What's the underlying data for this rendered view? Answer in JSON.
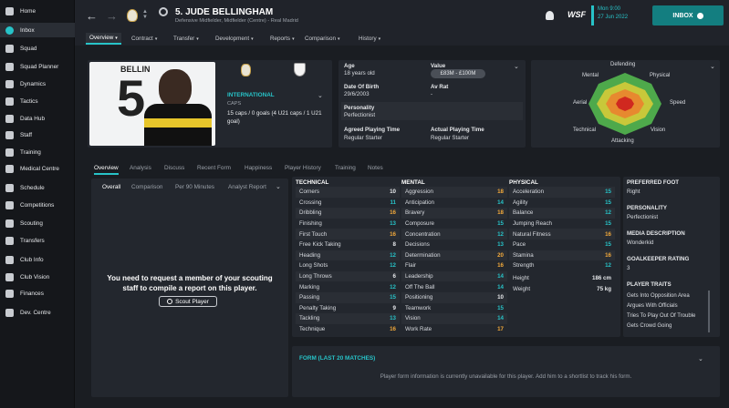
{
  "sidebar": [
    {
      "label": "Home",
      "icon": "home-icon"
    },
    {
      "label": "Inbox",
      "icon": "inbox-icon"
    },
    {
      "label": "Squad",
      "icon": "squad-icon"
    },
    {
      "label": "Squad Planner",
      "icon": "planner-icon"
    },
    {
      "label": "Dynamics",
      "icon": "dynamics-icon"
    },
    {
      "label": "Tactics",
      "icon": "tactics-icon"
    },
    {
      "label": "Data Hub",
      "icon": "data-hub-icon"
    },
    {
      "label": "Staff",
      "icon": "staff-icon"
    },
    {
      "label": "Training",
      "icon": "training-icon"
    },
    {
      "label": "Medical Centre",
      "icon": "medical-icon"
    },
    {
      "label": "Schedule",
      "icon": "calendar-icon"
    },
    {
      "label": "Competitions",
      "icon": "trophy-icon"
    },
    {
      "label": "Scouting",
      "icon": "scouting-icon"
    },
    {
      "label": "Transfers",
      "icon": "transfers-icon"
    },
    {
      "label": "Club Info",
      "icon": "shield-icon"
    },
    {
      "label": "Club Vision",
      "icon": "vision-icon"
    },
    {
      "label": "Finances",
      "icon": "finances-icon"
    },
    {
      "label": "Dev. Centre",
      "icon": "dev-centre-icon"
    }
  ],
  "header": {
    "name": "5. JUDE BELLINGHAM",
    "subtitle": "Defensive Midfielder, Midfielder (Centre) - Real Madrid",
    "day": "Mon 9:00",
    "date": "27 Jun 2022",
    "inbox": "INBOX",
    "brand": "WSF"
  },
  "tabs": [
    "Overview",
    "Contract",
    "Transfer",
    "Development",
    "Reports",
    "Comparison",
    "History"
  ],
  "profile": {
    "shirt_name": "BELLIN",
    "intl_label": "INTERNATIONAL",
    "caps_label": "CAPS",
    "caps_text": "15 caps / 0 goals (4 U21 caps / 1 U21 goal)"
  },
  "info": {
    "age_label": "Age",
    "age": "18 years old",
    "value_label": "Value",
    "value": "£83M - £100M",
    "dob_label": "Date Of Birth",
    "dob": "29/6/2003",
    "avrat_label": "Av Rat",
    "avrat": "-",
    "pers_label": "Personality",
    "pers": "Perfectionist",
    "apt_label": "Agreed Playing Time",
    "apt": "Regular Starter",
    "act_label": "Actual Playing Time",
    "act": "Regular Starter"
  },
  "radar": {
    "labels": [
      "Defending",
      "Physical",
      "Speed",
      "Vision",
      "Attacking",
      "Technical",
      "Aerial",
      "Mental"
    ]
  },
  "subtabs": [
    "Overview",
    "Analysis",
    "Discuss",
    "Recent Form",
    "Happiness",
    "Player History",
    "Training",
    "Notes"
  ],
  "report_tabs": [
    "Overall",
    "Comparison",
    "Per 90 Minutes",
    "Analyst Report"
  ],
  "scout": {
    "message": "You need to request a member of your scouting staff to compile a report on this player.",
    "button": "Scout Player"
  },
  "technical": {
    "title": "TECHNICAL",
    "rows": [
      [
        "Corners",
        "10"
      ],
      [
        "Crossing",
        "11"
      ],
      [
        "Dribbling",
        "16"
      ],
      [
        "Finishing",
        "13"
      ],
      [
        "First Touch",
        "16"
      ],
      [
        "Free Kick Taking",
        "8"
      ],
      [
        "Heading",
        "12"
      ],
      [
        "Long Shots",
        "12"
      ],
      [
        "Long Throws",
        "6"
      ],
      [
        "Marking",
        "12"
      ],
      [
        "Passing",
        "15"
      ],
      [
        "Penalty Taking",
        "9"
      ],
      [
        "Tackling",
        "13"
      ],
      [
        "Technique",
        "16"
      ]
    ]
  },
  "mental": {
    "title": "MENTAL",
    "rows": [
      [
        "Aggression",
        "18"
      ],
      [
        "Anticipation",
        "14"
      ],
      [
        "Bravery",
        "18"
      ],
      [
        "Composure",
        "15"
      ],
      [
        "Concentration",
        "12"
      ],
      [
        "Decisions",
        "13"
      ],
      [
        "Determination",
        "20"
      ],
      [
        "Flair",
        "16"
      ],
      [
        "Leadership",
        "14"
      ],
      [
        "Off The Ball",
        "14"
      ],
      [
        "Positioning",
        "10"
      ],
      [
        "Teamwork",
        "15"
      ],
      [
        "Vision",
        "14"
      ],
      [
        "Work Rate",
        "17"
      ]
    ]
  },
  "physical": {
    "title": "PHYSICAL",
    "rows": [
      [
        "Acceleration",
        "15"
      ],
      [
        "Agility",
        "15"
      ],
      [
        "Balance",
        "12"
      ],
      [
        "Jumping Reach",
        "15"
      ],
      [
        "Natural Fitness",
        "16"
      ],
      [
        "Pace",
        "15"
      ],
      [
        "Stamina",
        "16"
      ],
      [
        "Strength",
        "12"
      ]
    ],
    "height_label": "Height",
    "height": "186 cm",
    "weight_label": "Weight",
    "weight": "75 kg"
  },
  "side": {
    "foot_label": "PREFERRED FOOT",
    "foot": "Right",
    "pers_label": "PERSONALITY",
    "pers": "Perfectionist",
    "media_label": "MEDIA DESCRIPTION",
    "media": "Wonderkid",
    "gk_label": "GOALKEEPER RATING",
    "gk": "3",
    "traits_label": "PLAYER TRAITS",
    "traits": [
      "Gets Into Opposition Area",
      "Argues With Officials",
      "Tries To Play Out Of Trouble",
      "Gets Crowd Going"
    ]
  },
  "form": {
    "title": "FORM (LAST 20 MATCHES)",
    "message": "Player form information is currently unavailable for this player. Add him to a shortlist to track his form."
  },
  "colors": {
    "accent": "#27c3c8",
    "high": "#e3c533",
    "top": "#f2a93b",
    "mid": "#27c3c8",
    "low": "#e6e8eb"
  }
}
